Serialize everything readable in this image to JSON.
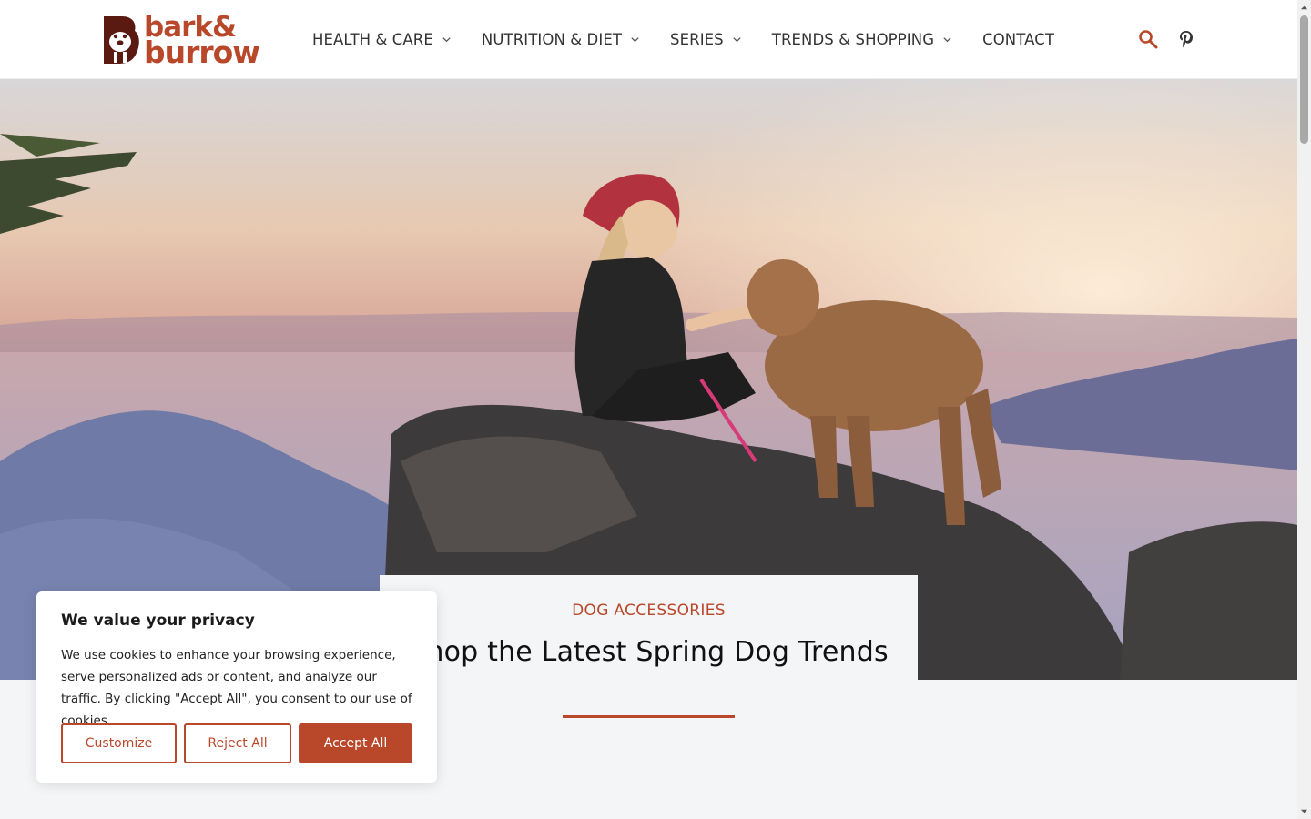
{
  "brand": {
    "name_line1": "bark&",
    "name_line2": "burrow",
    "accent": "#b9472a"
  },
  "nav": {
    "items": [
      {
        "label": "HEALTH & CARE",
        "has_dropdown": true
      },
      {
        "label": "NUTRITION & DIET",
        "has_dropdown": true
      },
      {
        "label": "SERIES",
        "has_dropdown": true
      },
      {
        "label": "TRENDS & SHOPPING",
        "has_dropdown": true
      },
      {
        "label": "CONTACT",
        "has_dropdown": false
      }
    ],
    "icons": [
      "search-icon",
      "pinterest-icon"
    ]
  },
  "feature": {
    "kicker": "DOG ACCESSORIES",
    "title": "Shop the Latest Spring Dog Trends"
  },
  "cookie": {
    "title": "We value your privacy",
    "body": "We use cookies to enhance your browsing experience, serve personalized ads or content, and analyze our traffic. By clicking \"Accept All\", you consent to our use of cookies.",
    "customize_label": "Customize",
    "reject_label": "Reject All",
    "accept_label": "Accept All"
  }
}
